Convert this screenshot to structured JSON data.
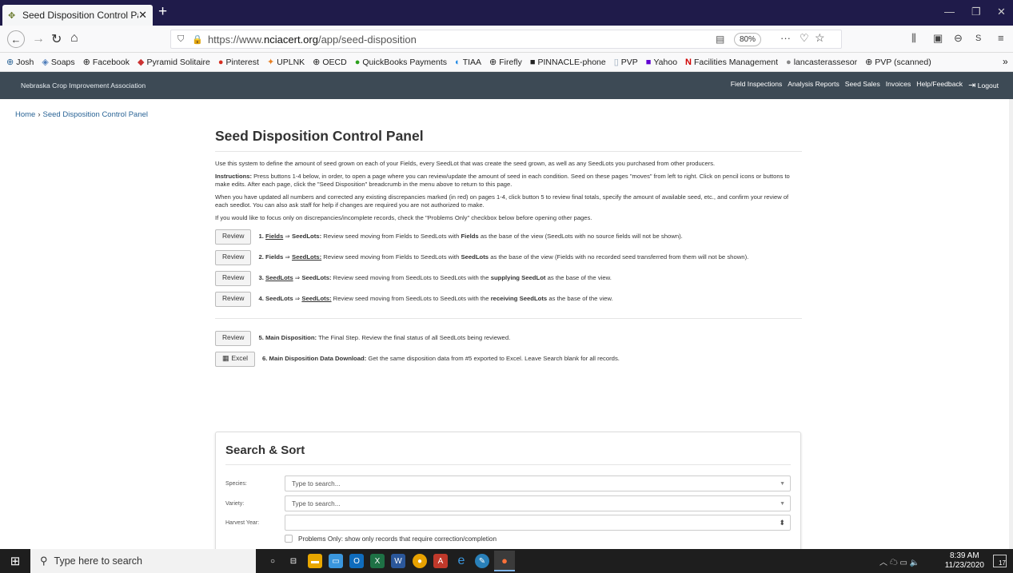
{
  "browser": {
    "tab_title": "Seed Disposition Control Panel",
    "tab_close": "✕",
    "new_tab": "+",
    "url_prefix": "https://www.",
    "url_domain": "nciacert.org",
    "url_path": "/app/seed-disposition",
    "zoom": "80%",
    "bookmarks": [
      "Josh",
      "Soaps",
      "Facebook",
      "Pyramid Solitaire",
      "Pinterest",
      "UPLNK",
      "OECD",
      "QuickBooks Payments",
      "TIAA",
      "Firefly",
      "PINNACLE-phone",
      "PVP",
      "Yahoo",
      "Facilities Management",
      "lancasterassesor",
      "PVP (scanned)"
    ]
  },
  "app": {
    "brand": "Nebraska Crop Improvement Association",
    "nav": [
      "Field Inspections",
      "Analysis Reports",
      "Seed Sales",
      "Invoices",
      "Help/Feedback"
    ],
    "logout": "Logout"
  },
  "breadcrumb": {
    "home": "Home",
    "sep": "›",
    "current": "Seed Disposition Control Panel"
  },
  "page": {
    "title": "Seed Disposition Control Panel",
    "intro": "Use this system to define the amount of seed grown on each of your Fields, every SeedLot that was create the seed grown, as well as any SeedLots you purchased from other producers.",
    "instructions_label": "Instructions:",
    "instructions": " Press buttons 1-4 below, in order, to open a page where you can review/update the amount of seed in each condition. Seed on these pages \"moves\" from left to right. Click on pencil icons or buttons to make edits. After each page, click the \"Seed Disposition\" breadcrumb in the menu above to return to this page.",
    "updated": "When you have updated all numbers and corrected any existing discrepancies marked (in red) on pages 1-4, click button 5 to review final totals, specify the amount of available seed, etc., and confirm your review of each seedlot. You can also ask staff for help if changes are required you are not authorized to make.",
    "focus": "If you would like to focus only on discrepancies/incomplete records, check the \"Problems Only\" checkbox below before opening other pages."
  },
  "steps": [
    {
      "button": "Review",
      "num": "1.",
      "a": "Fields",
      "arrow": "⇒",
      "b": "SeedLots:",
      "text1": " Review seed moving from Fields to SeedLots with ",
      "bold": "Fields",
      "text2": " as the base of the view (SeedLots with no source fields will not be shown)."
    },
    {
      "button": "Review",
      "num": "2.",
      "a": "Fields",
      "arrow": "⇒",
      "b": "SeedLots:",
      "text1": " Review seed moving from Fields to SeedLots with ",
      "bold": "SeedLots",
      "text2": " as the base of the view (Fields with no recorded seed transferred from them will not be shown)."
    },
    {
      "button": "Review",
      "num": "3.",
      "a": "SeedLots",
      "arrow": "⇒",
      "b": "SeedLots:",
      "text1": " Review seed moving from SeedLots to SeedLots with the ",
      "bold": "supplying SeedLot",
      "text2": " as the base of the view."
    },
    {
      "button": "Review",
      "num": "4.",
      "a": "SeedLots",
      "arrow": "⇒",
      "b": "SeedLots:",
      "text1": " Review seed moving from SeedLots to SeedLots with the ",
      "bold": "receiving SeedLots",
      "text2": " as the base of the view."
    }
  ],
  "step5": {
    "button": "Review",
    "label": "5. Main Disposition:",
    "text": " The Final Step. Review the final status of all SeedLots being reviewed."
  },
  "step6": {
    "button": "Excel",
    "label": "6. Main Disposition Data Download:",
    "text": " Get the same disposition data from #5 exported to Excel. Leave Search blank for all records."
  },
  "search": {
    "title": "Search & Sort",
    "species_label": "Species:",
    "species_placeholder": "Type to search...",
    "variety_label": "Variety:",
    "variety_placeholder": "Type to search...",
    "year_label": "Harvest Year:",
    "problems_only": "Problems Only: show only records that require correction/completion"
  },
  "taskbar": {
    "search": "Type here to search",
    "time": "8:39 AM",
    "date": "11/23/2020",
    "notif": "17"
  }
}
